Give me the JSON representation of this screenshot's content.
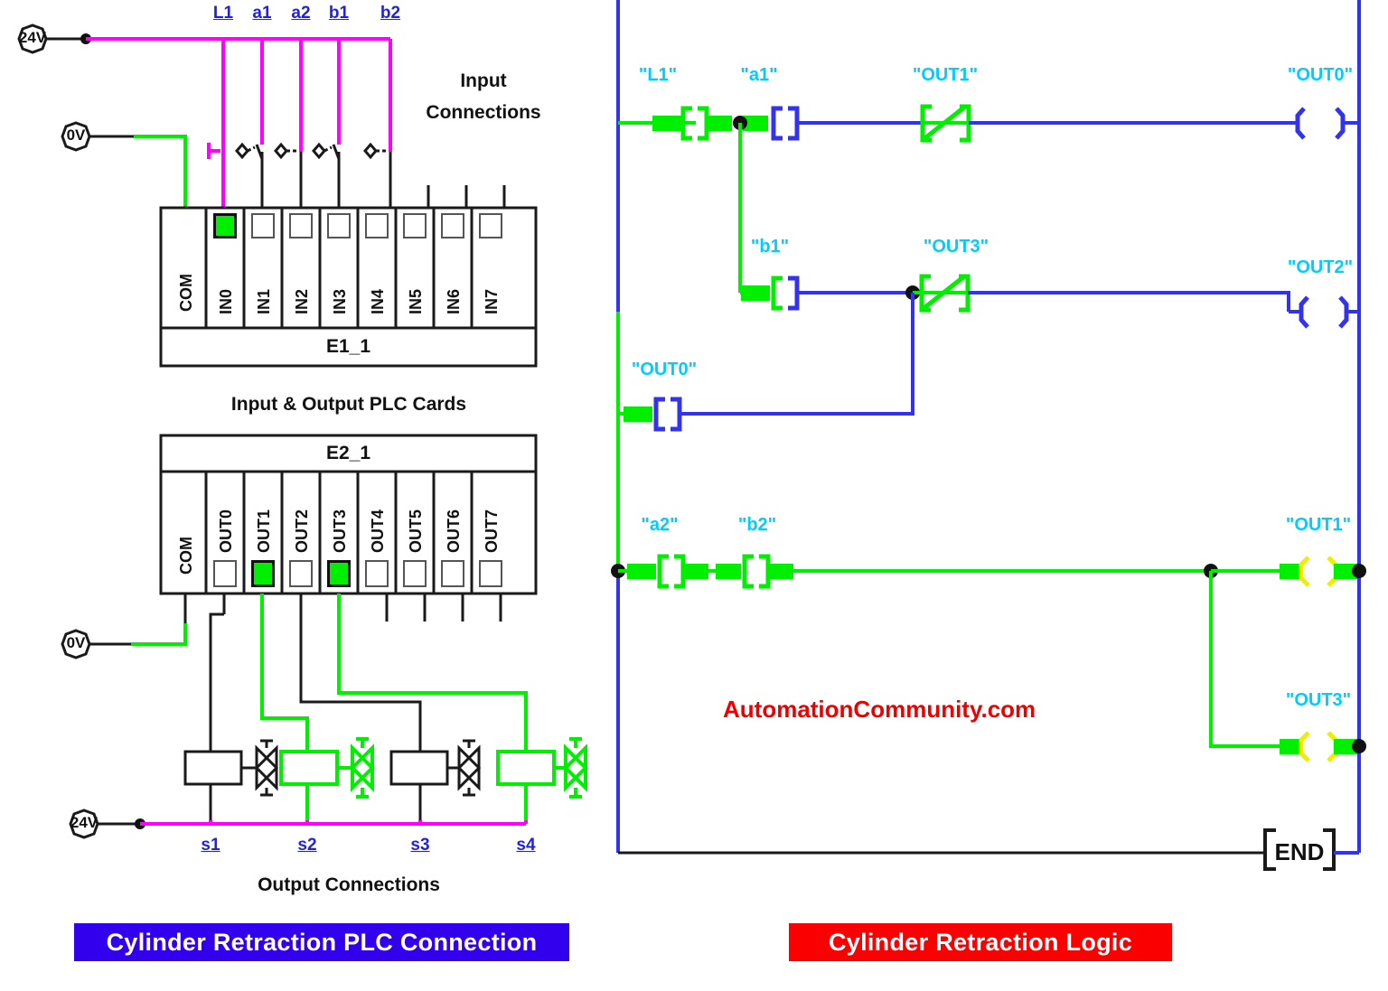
{
  "left_panel": {
    "title_input": "Input\nConnections",
    "title_input_line1": "Input",
    "title_input_line2": "Connections",
    "title_cards": "Input & Output PLC Cards",
    "title_output": "Output  Connections",
    "supply_top": "24V",
    "supply_zero_in": "0V",
    "supply_zero_out": "0V",
    "supply_bottom": "24V",
    "input_signal_labels": [
      "L1",
      "a1",
      "a2",
      "b1",
      "b2"
    ],
    "input_card": {
      "name": "E1_1",
      "common_label": "COM",
      "terminals": [
        {
          "label": "IN0",
          "active": true
        },
        {
          "label": "IN1",
          "active": false
        },
        {
          "label": "IN2",
          "active": false
        },
        {
          "label": "IN3",
          "active": false
        },
        {
          "label": "IN4",
          "active": false
        },
        {
          "label": "IN5",
          "active": false
        },
        {
          "label": "IN6",
          "active": false
        },
        {
          "label": "IN7",
          "active": false
        }
      ]
    },
    "output_card": {
      "name": "E2_1",
      "common_label": "COM",
      "terminals": [
        {
          "label": "OUT0",
          "active": false
        },
        {
          "label": "OUT1",
          "active": true
        },
        {
          "label": "OUT2",
          "active": false
        },
        {
          "label": "OUT3",
          "active": true
        },
        {
          "label": "OUT4",
          "active": false
        },
        {
          "label": "OUT5",
          "active": false
        },
        {
          "label": "OUT6",
          "active": false
        },
        {
          "label": "OUT7",
          "active": false
        }
      ]
    },
    "solenoid_labels": [
      "s1",
      "s2",
      "s3",
      "s4"
    ]
  },
  "ladder": {
    "watermark": "AutomationCommunity.com",
    "end_label": "END",
    "rungs": [
      {
        "contacts": [
          {
            "tag": "\"L1\"",
            "type": "no",
            "active": true
          },
          {
            "tag": "\"a1\"",
            "type": "no",
            "active": true
          },
          {
            "tag": "\"OUT1\"",
            "type": "nc",
            "active": true
          }
        ],
        "coil": {
          "tag": "\"OUT0\"",
          "active": false
        }
      },
      {
        "contacts": [
          {
            "tag": "\"b1\"",
            "type": "no",
            "active": true
          },
          {
            "tag": "\"OUT3\"",
            "type": "nc",
            "active": true
          }
        ],
        "branch": [
          {
            "tag": "\"OUT0\"",
            "type": "no",
            "active": true
          }
        ],
        "coil": {
          "tag": "\"OUT2\"",
          "active": false
        }
      },
      {
        "contacts": [
          {
            "tag": "\"a2\"",
            "type": "no",
            "active": true
          },
          {
            "tag": "\"b2\"",
            "type": "no",
            "active": true
          }
        ],
        "coils": [
          {
            "tag": "\"OUT1\"",
            "active": true
          },
          {
            "tag": "\"OUT3\"",
            "active": true
          }
        ]
      }
    ]
  },
  "captions": {
    "left": "Cylinder Retraction PLC Connection",
    "right": "Cylinder Retraction Logic"
  },
  "colors": {
    "magenta": "#ff00ff",
    "green": "#00ee00",
    "blue": "#3333ee",
    "black": "#1a1a1a",
    "tag_cyan": "#00ccff",
    "label_blue": "#2222dd",
    "caption_left_bg": "#3300ee",
    "caption_right_bg": "#fa0000",
    "watermark_red": "#ee0000"
  }
}
